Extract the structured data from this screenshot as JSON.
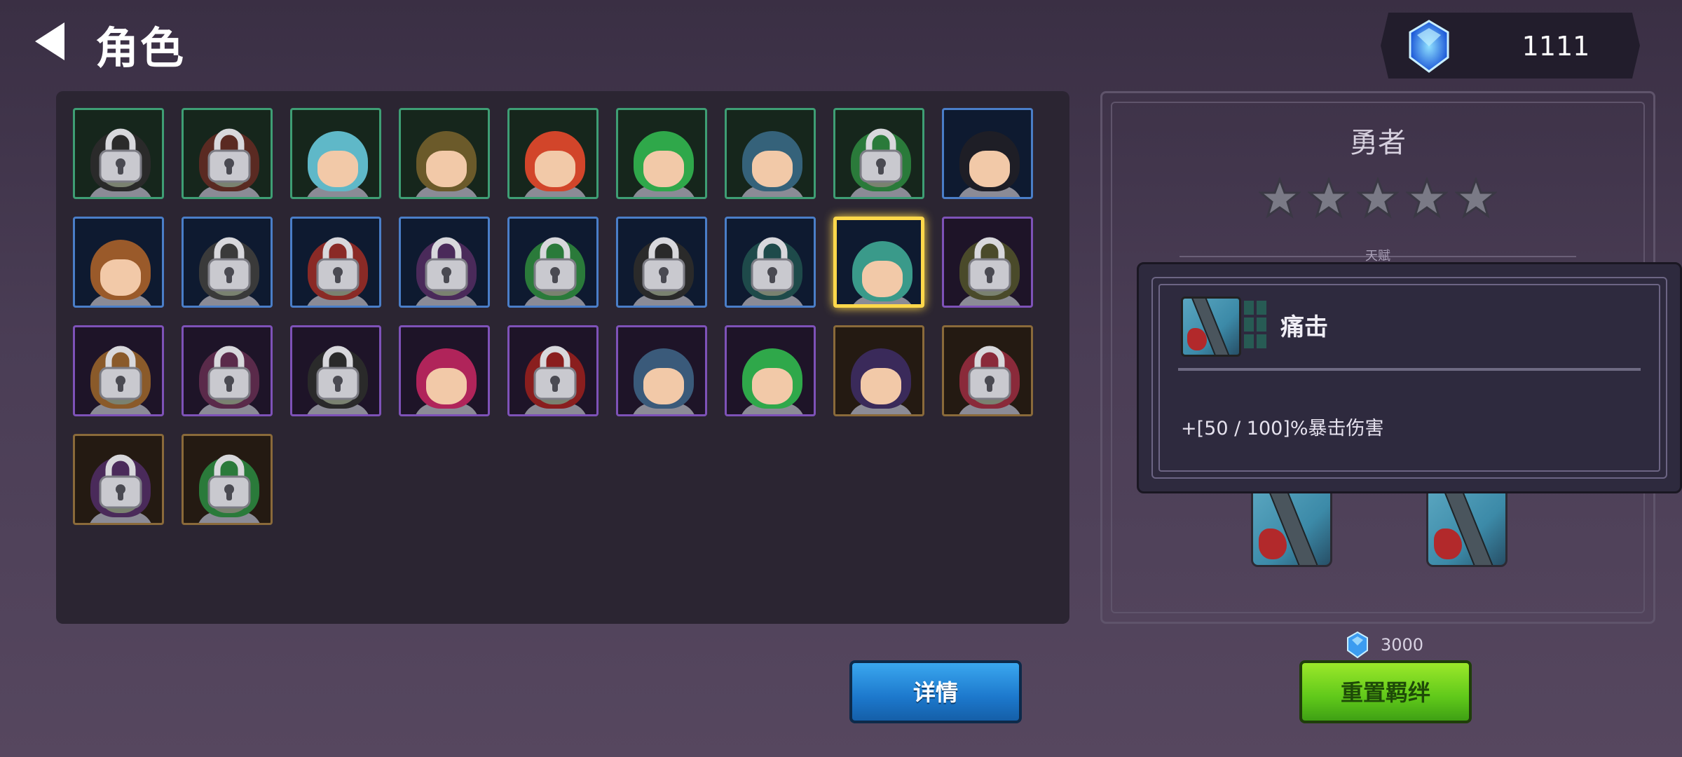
{
  "header": {
    "title": "角色",
    "gem_count": "1111"
  },
  "roster": [
    {
      "rarity": "green",
      "locked": true,
      "hair": "#2a2a2a"
    },
    {
      "rarity": "green",
      "locked": true,
      "hair": "#5a2a22"
    },
    {
      "rarity": "green",
      "locked": false,
      "hair": "#5fb8c8"
    },
    {
      "rarity": "green",
      "locked": false,
      "hair": "#6b5a2a"
    },
    {
      "rarity": "green",
      "locked": false,
      "hair": "#d2452a"
    },
    {
      "rarity": "green",
      "locked": false,
      "hair": "#2fa84a"
    },
    {
      "rarity": "green",
      "locked": false,
      "hair": "#35627a"
    },
    {
      "rarity": "green",
      "locked": true,
      "hair": "#2a7a3a"
    },
    {
      "rarity": "blue",
      "locked": false,
      "hair": "#1e1e26"
    },
    {
      "rarity": "blue",
      "locked": false,
      "hair": "#9a5a2a"
    },
    {
      "rarity": "blue",
      "locked": true,
      "hair": "#3a3a3a"
    },
    {
      "rarity": "blue",
      "locked": true,
      "hair": "#8a2a26"
    },
    {
      "rarity": "blue",
      "locked": true,
      "hair": "#4a2a5a"
    },
    {
      "rarity": "blue",
      "locked": true,
      "hair": "#2a7a3a"
    },
    {
      "rarity": "blue",
      "locked": true,
      "hair": "#2a2a2a"
    },
    {
      "rarity": "blue",
      "locked": true,
      "hair": "#1e4a4a"
    },
    {
      "rarity": "blue",
      "locked": false,
      "hair": "#3a9a8a",
      "selected": true
    },
    {
      "rarity": "purple",
      "locked": true,
      "hair": "#4a4a2a"
    },
    {
      "rarity": "purple",
      "locked": true,
      "hair": "#8a5a2a"
    },
    {
      "rarity": "purple",
      "locked": true,
      "hair": "#5a2a4a"
    },
    {
      "rarity": "purple",
      "locked": true,
      "hair": "#2a2a2a"
    },
    {
      "rarity": "purple",
      "locked": false,
      "hair": "#b0245a"
    },
    {
      "rarity": "purple",
      "locked": true,
      "hair": "#8a1e1e"
    },
    {
      "rarity": "purple",
      "locked": false,
      "hair": "#3a5a7a"
    },
    {
      "rarity": "purple",
      "locked": false,
      "hair": "#2fa84a"
    },
    {
      "rarity": "orange",
      "locked": false,
      "hair": "#3a2a5a"
    },
    {
      "rarity": "orange",
      "locked": true,
      "hair": "#8a2a3a"
    },
    {
      "rarity": "orange",
      "locked": true,
      "hair": "#4a2a5a"
    },
    {
      "rarity": "orange",
      "locked": true,
      "hair": "#2a7a3a"
    }
  ],
  "rarity_colors": {
    "green": {
      "bg": "#16261c",
      "border": "#3e9e74"
    },
    "blue": {
      "bg": "#0e1a30",
      "border": "#4a7ec8"
    },
    "purple": {
      "bg": "#1e1428",
      "border": "#7e52b8"
    },
    "orange": {
      "bg": "#241a12",
      "border": "#8a6a3a"
    }
  },
  "hero": {
    "name": "勇者",
    "stars": 5,
    "talent_label": "天赋"
  },
  "popup": {
    "skill_name": "痛击",
    "description": "+[50 / 100]%暴击伤害"
  },
  "cost": {
    "value": "3000"
  },
  "buttons": {
    "details": "详情",
    "reset": "重置羁绊"
  },
  "colors": {
    "accent_gem": "#4ab8ff",
    "selected_border": "#ffd84a"
  }
}
